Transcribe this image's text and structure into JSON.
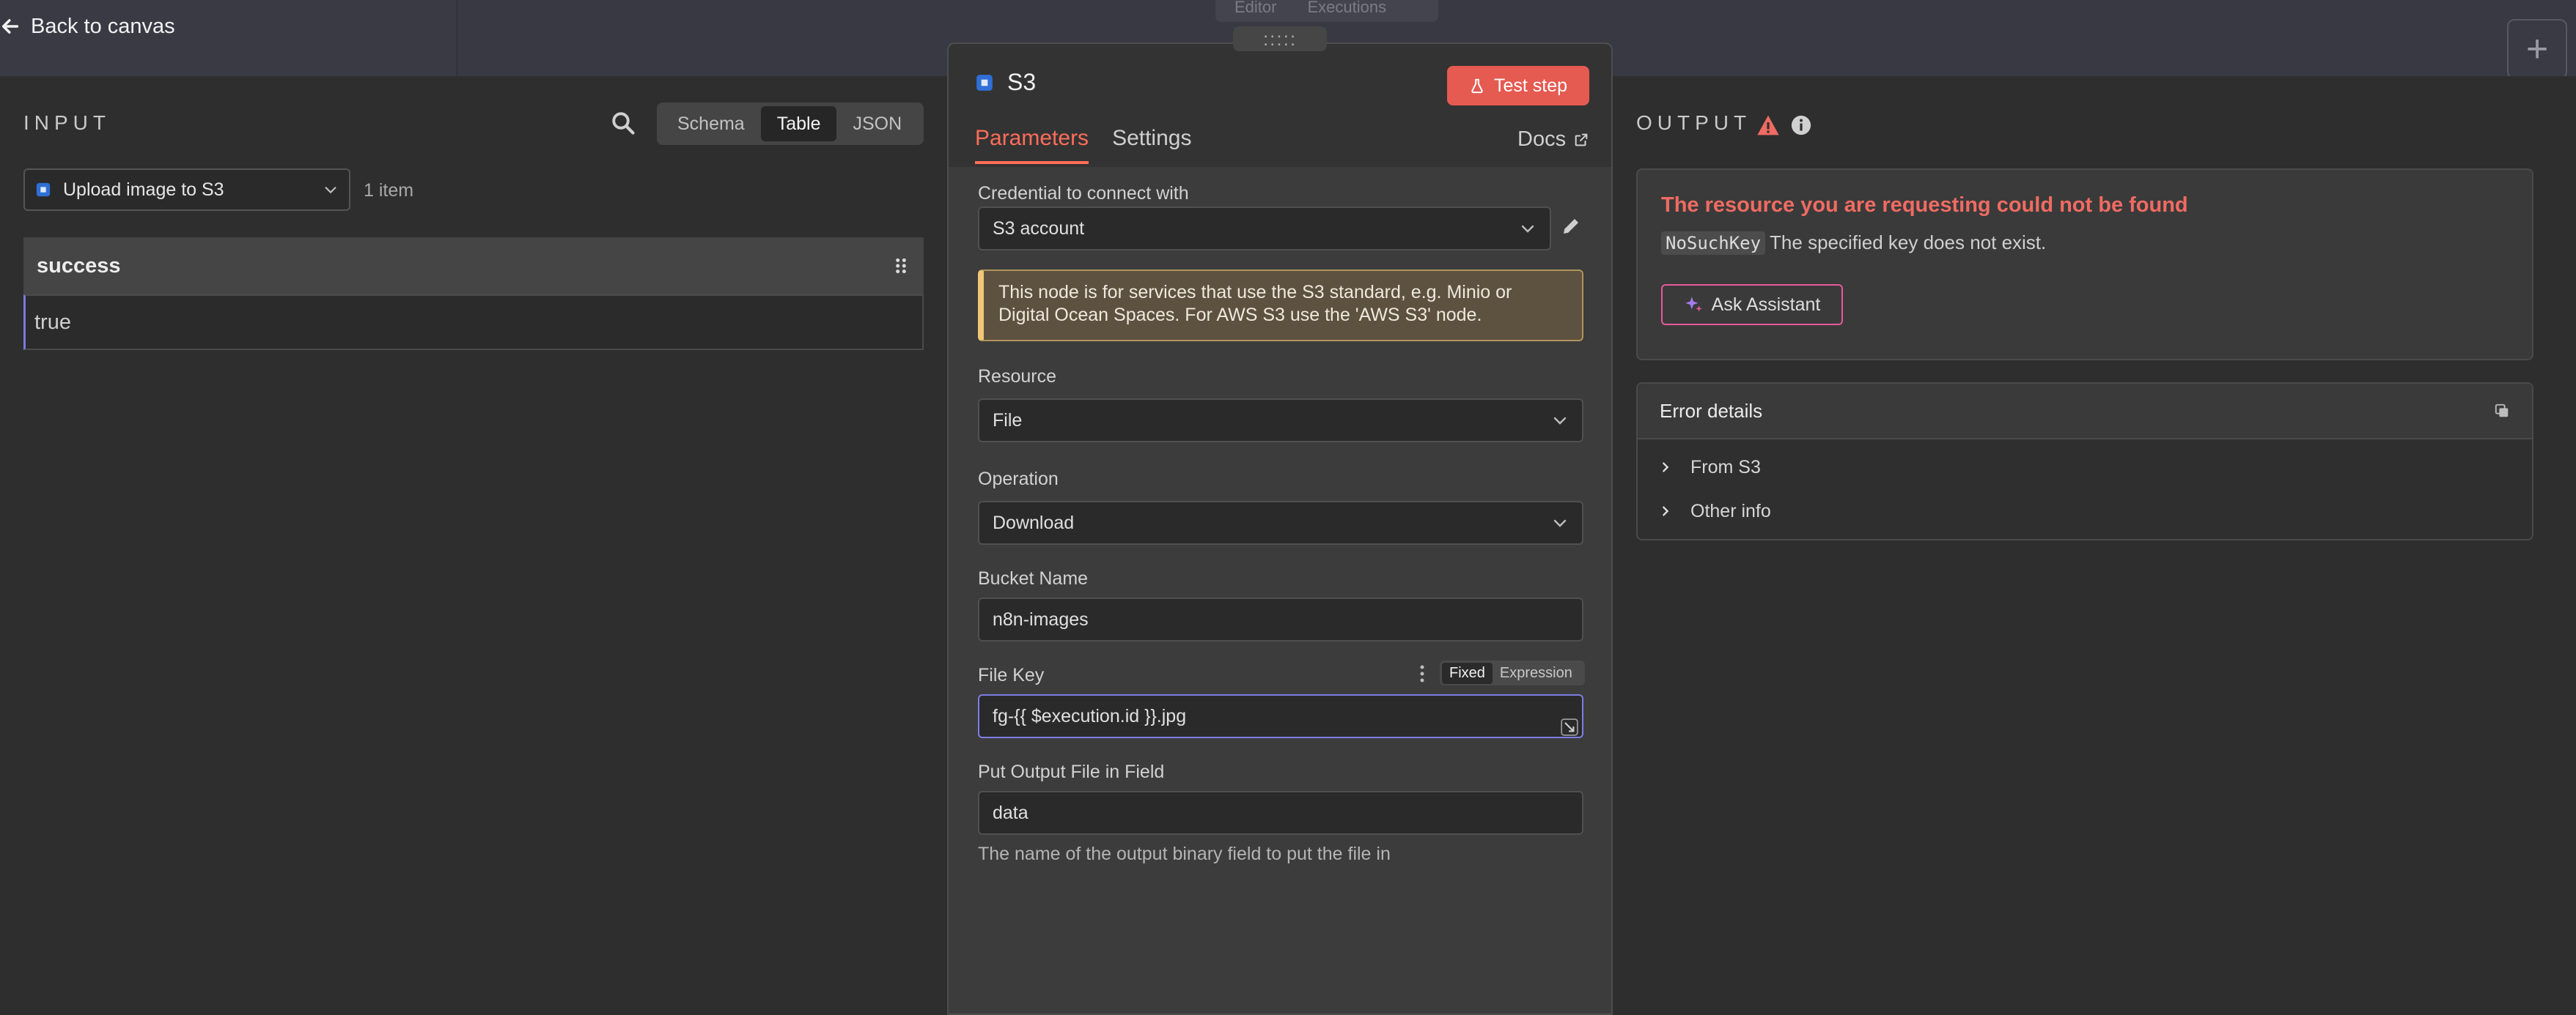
{
  "topbar": {
    "back_label": "Back to canvas",
    "mode_tabs": [
      "Editor",
      "Executions"
    ],
    "add_label": "+"
  },
  "input": {
    "title": "INPUT",
    "view_tabs": [
      {
        "label": "Schema",
        "active": false
      },
      {
        "label": "Table",
        "active": true
      },
      {
        "label": "JSON",
        "active": false
      }
    ],
    "node_selector": "Upload image to S3",
    "item_count": "1 item",
    "table": {
      "column": "success",
      "value": "true"
    }
  },
  "node": {
    "drag_label": ":::::",
    "title": "S3",
    "test_button": "Test step",
    "tabs": [
      {
        "label": "Parameters",
        "active": true
      },
      {
        "label": "Settings",
        "active": false
      }
    ],
    "docs_label": "Docs",
    "credential": {
      "label": "Credential to connect with",
      "value": "S3 account"
    },
    "notice": "This node is for services that use the S3 standard, e.g. Minio or Digital Ocean Spaces. For AWS S3 use the 'AWS S3' node.",
    "resource": {
      "label": "Resource",
      "value": "File"
    },
    "operation": {
      "label": "Operation",
      "value": "Download"
    },
    "bucket": {
      "label": "Bucket Name",
      "value": "n8n-images"
    },
    "file_key": {
      "label": "File Key",
      "value": "fg-{{ $execution.id }}.jpg",
      "mode_fixed": "Fixed",
      "mode_expression": "Expression"
    },
    "output_field": {
      "label": "Put Output File in Field",
      "value": "data",
      "hint": "The name of the output binary field to put the file in"
    }
  },
  "output": {
    "title": "OUTPUT",
    "error": {
      "title": "The resource you are requesting could not be found",
      "code": "NoSuchKey",
      "message": "The specified key does not exist.",
      "assistant_button": "Ask Assistant"
    },
    "details": {
      "title": "Error details",
      "rows": [
        "From S3",
        "Other info"
      ]
    }
  },
  "colors": {
    "accent": "#ff6d5a",
    "error": "#f06b62",
    "focus": "#7d7de6",
    "warning": "#f0c777"
  }
}
